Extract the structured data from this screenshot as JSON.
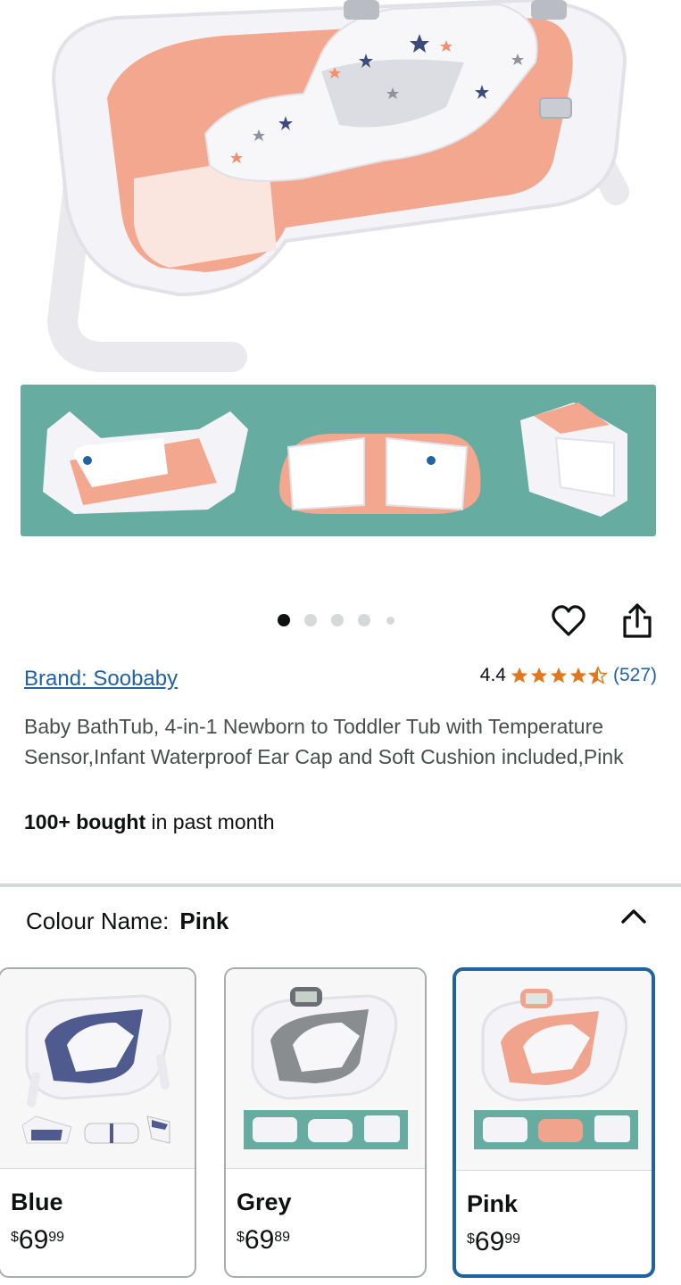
{
  "gallery": {
    "image_count": 5,
    "active_index": 0
  },
  "actions": {
    "wishlist_icon": "heart-icon",
    "share_icon": "share-icon"
  },
  "product": {
    "brand_link": "Brand: Soobaby",
    "rating_value": "4.4",
    "rating_stars": 4.4,
    "review_count": "(527)",
    "title": "Baby BathTub, 4-in-1 Newborn to Toddler Tub with Temperature Sensor,Infant Waterproof Ear Cap and Soft Cushion included,Pink",
    "bought_bold": "100+ bought",
    "bought_rest": " in past month"
  },
  "variations": {
    "label": "Colour Name:",
    "selected_value": "Pink",
    "collapse_icon": "chevron-up-icon",
    "options": [
      {
        "name": "Blue",
        "currency": "$",
        "whole": "69",
        "fraction": "99",
        "color": "#4f5b8f"
      },
      {
        "name": "Grey",
        "currency": "$",
        "whole": "69",
        "fraction": "89",
        "color": "#8a8d90"
      },
      {
        "name": "Pink",
        "currency": "$",
        "whole": "69",
        "fraction": "99",
        "color": "#f0a48e"
      }
    ]
  },
  "colors": {
    "link": "#2162a1",
    "star": "#de7921",
    "tub_pink": "#f4a78f",
    "strip_teal": "#67aca1",
    "selected_border": "#2162a1"
  }
}
